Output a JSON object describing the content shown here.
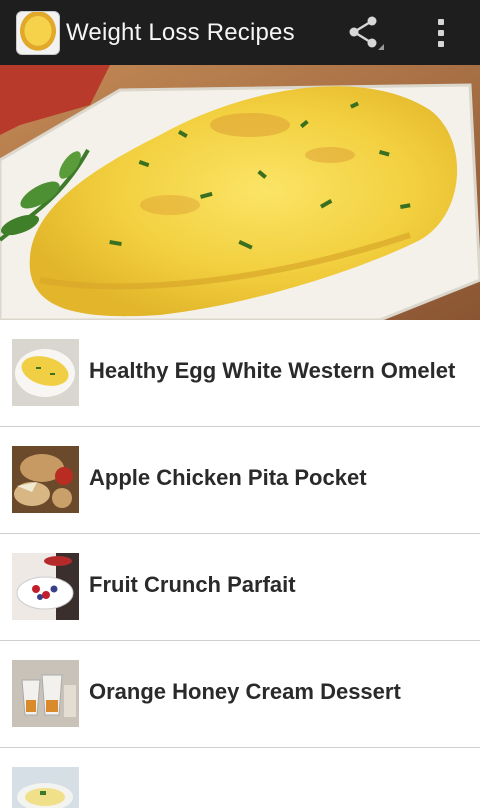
{
  "app": {
    "title": "Weight Loss Recipes",
    "icon": "omelet-app-icon",
    "colors": {
      "actionbar": "#1e1e1e",
      "list_bg": "#ffffff",
      "title_text": "#2a2a2a"
    }
  },
  "toolbar": {
    "share_icon": "share-icon",
    "overflow_icon": "overflow-menu-icon"
  },
  "hero": {
    "image": "omelet-photo"
  },
  "recipes": [
    {
      "title": "Healthy Egg White Western Omelet",
      "thumb": "omelet-thumb"
    },
    {
      "title": "Apple Chicken Pita Pocket",
      "thumb": "pita-thumb"
    },
    {
      "title": "Fruit Crunch Parfait",
      "thumb": "parfait-thumb"
    },
    {
      "title": "Orange Honey Cream Dessert",
      "thumb": "dessert-thumb"
    },
    {
      "title": "",
      "thumb": "soup-thumb"
    }
  ]
}
